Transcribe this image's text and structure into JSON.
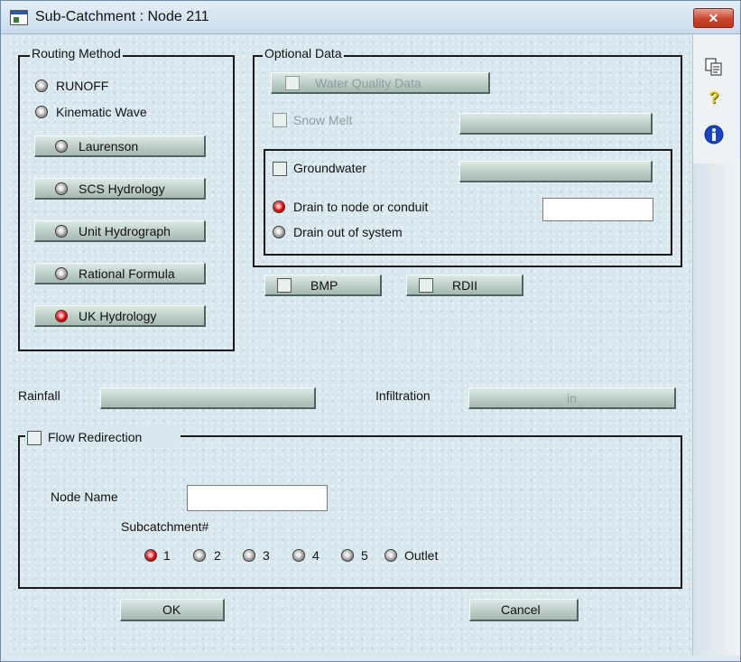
{
  "window": {
    "title": "Sub-Catchment : Node 211",
    "close_label": "✕"
  },
  "side_icons": {
    "copy": "copy-icon",
    "help": "?",
    "info": "i"
  },
  "routing": {
    "label": "Routing Method",
    "runoff": "RUNOFF",
    "kinematic": "Kinematic Wave",
    "buttons": [
      "Laurenson",
      "SCS Hydrology",
      "Unit Hydrograph",
      "Rational Formula",
      "UK Hydrology"
    ],
    "selected": "UK Hydrology"
  },
  "optional": {
    "label": "Optional Data",
    "water_quality": "Water Quality Data",
    "snow_melt": "Snow Melt",
    "groundwater": "Groundwater",
    "drain_node": "Drain to node or conduit",
    "drain_out": "Drain out of system",
    "drain_node_value": ""
  },
  "bmp": "BMP",
  "rdii": "RDII",
  "rainfall": {
    "label": "Rainfall",
    "value": ""
  },
  "infiltration": {
    "label": "Infiltration",
    "value": "in"
  },
  "flow": {
    "label": "Flow Redirection",
    "node_name_label": "Node Name",
    "node_name_value": "",
    "subcatchment_label": "Subcatchment#",
    "options": [
      "1",
      "2",
      "3",
      "4",
      "5",
      "Outlet"
    ]
  },
  "ok": "OK",
  "cancel": "Cancel"
}
